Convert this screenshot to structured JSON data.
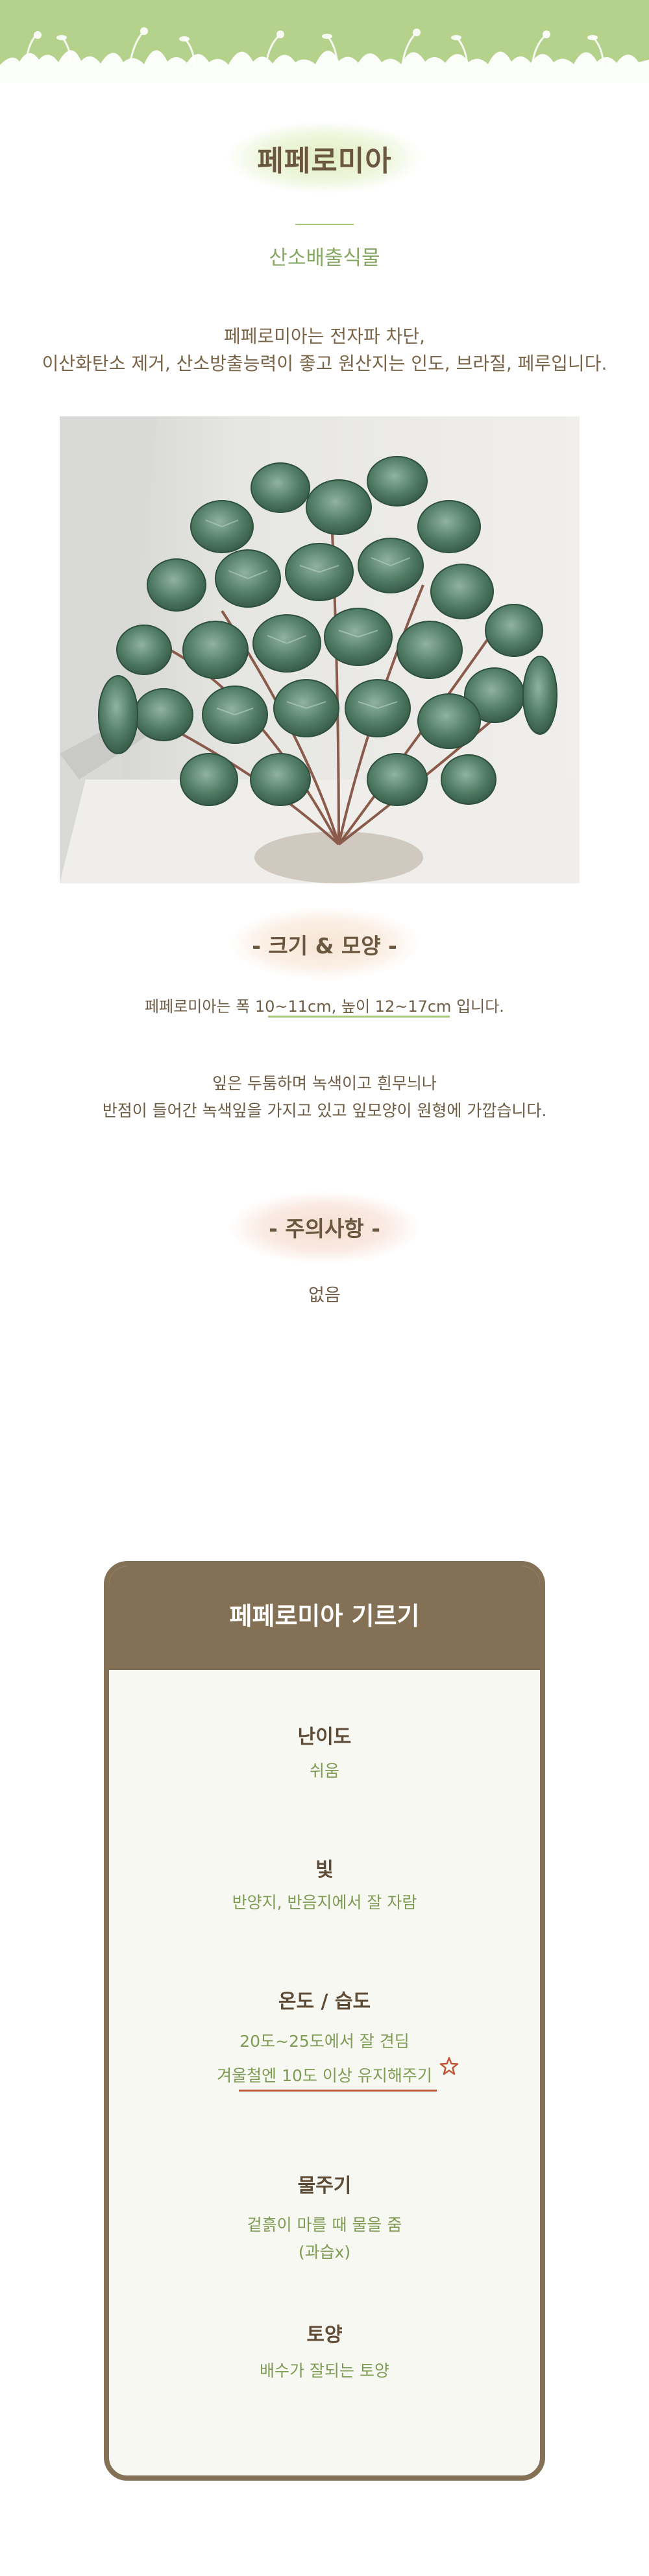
{
  "title": "페페로미아",
  "subtitle": "산소배출식물",
  "intro": {
    "line1": "페페로미아는 전자파 차단,",
    "line2": "이산화탄소 제거, 산소방출능력이 좋고 원산지는 인도, 브라질, 페루입니다."
  },
  "photo_alt": "페페로미아",
  "size_section": {
    "title": "- 크기 & 모양 -",
    "size_text": "페페로미아는 폭 10~11cm, 높이 12~17cm 입니다.",
    "shape_line1": "잎은 두툼하며 녹색이고 흰무늬나",
    "shape_line2": "반점이 들어간 녹색잎을 가지고 있고 잎모양이 원형에 가깝습니다."
  },
  "caution_section": {
    "title": "- 주의사항 -",
    "text": "없음"
  },
  "care_card": {
    "title": "페페로미아 기르기",
    "items": [
      {
        "label": "난이도",
        "values": [
          "쉬움"
        ]
      },
      {
        "label": "빛",
        "values": [
          "반양지, 반음지에서 잘 자람"
        ]
      },
      {
        "label": "온도 / 습도",
        "values": [
          "20도~25도에서 잘 견딤",
          "겨울철엔 10도 이상 유지해주기"
        ]
      },
      {
        "label": "물주기",
        "values": [
          "겉흙이 마를 때 물을 줌",
          "(과습x)"
        ]
      },
      {
        "label": "토양",
        "values": [
          "배수가 잘되는 토양"
        ]
      }
    ]
  },
  "icons": {
    "note_star": "star-icon",
    "banner": "grass-silhouette"
  },
  "colors": {
    "banner_green": "#b5d28c",
    "text_brown": "#6f5c45",
    "card_brown": "#837055",
    "value_green": "#7f9c55",
    "accent_red": "#c0573a"
  }
}
